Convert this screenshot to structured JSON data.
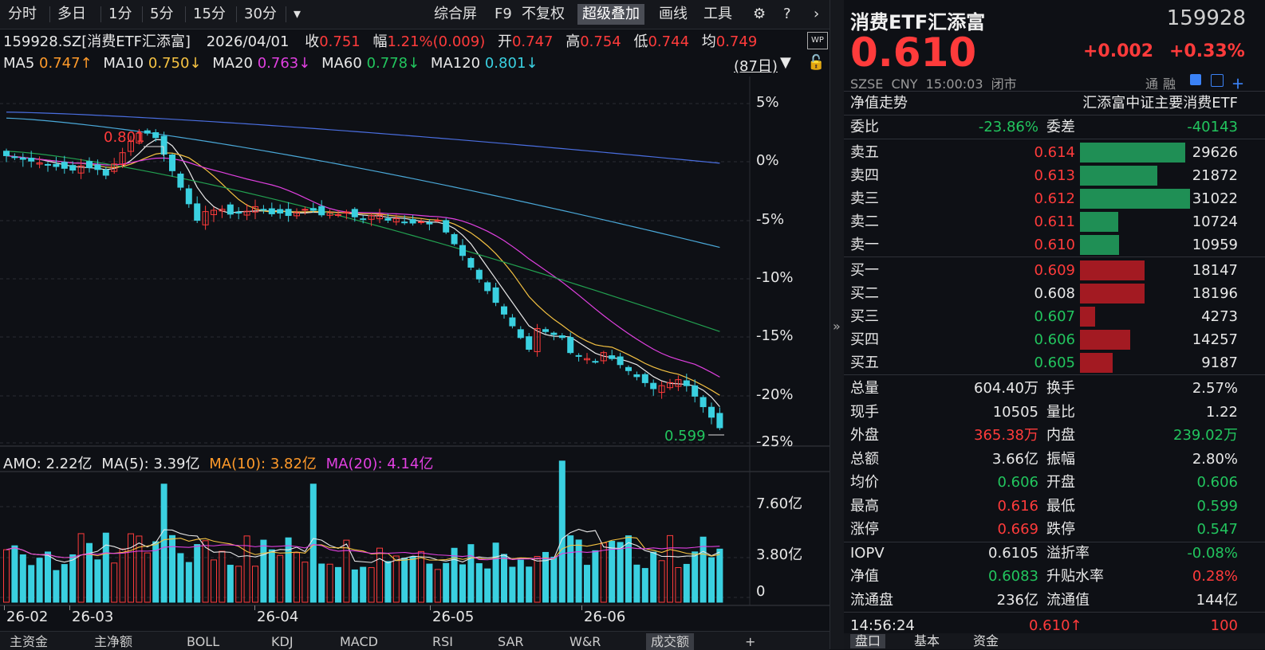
{
  "toolbar": {
    "left_items": [
      "分时",
      "多日",
      "1分",
      "5分",
      "15分",
      "30分",
      "▾"
    ],
    "right_items": [
      "综合屏",
      "F9",
      "不复权",
      "超级叠加",
      "画线",
      "工具"
    ],
    "active": "超级叠加"
  },
  "quote_line": {
    "code": "159928.SZ[消费ETF汇添富]",
    "date": "2026/04/01",
    "close_label": "收",
    "close": "0.751",
    "change_label": "幅",
    "change": "1.21%(0.009)",
    "open_label": "开",
    "open": "0.747",
    "high_label": "高",
    "high": "0.754",
    "low_label": "低",
    "low": "0.744",
    "avg_label": "均",
    "avg": "0.749"
  },
  "ma_line": {
    "ma5_label": "MA5",
    "ma5": "0.747↑",
    "ma10_label": "MA10",
    "ma10": "0.750↓",
    "ma20_label": "MA20",
    "ma20": "0.763↓",
    "ma60_label": "MA60",
    "ma60": "0.778↓",
    "ma120_label": "MA120",
    "ma120": "0.801↓",
    "days": "(87日)"
  },
  "chart_labels": {
    "pct_axis": [
      "5%",
      "0%",
      "-5%",
      "-10%",
      "-15%",
      "-20%",
      "-25%"
    ],
    "vol_axis": [
      "7.60亿",
      "3.80亿",
      "0"
    ],
    "max_mark": "0.801",
    "min_mark": "0.599",
    "amo_label": "AMO: 2.22亿",
    "amo_ma5": "MA(5): 3.39亿",
    "amo_ma10": "MA(10): 3.82亿",
    "amo_ma20": "MA(20): 4.14亿",
    "date_axis": [
      "26-02",
      "26-03",
      "26-04",
      "26-05",
      "26-06"
    ]
  },
  "bottom_tabs": [
    "主资金",
    "主净额",
    "BOLL",
    "KDJ",
    "MACD",
    "RSI",
    "SAR",
    "W&R",
    "成交额",
    "+"
  ],
  "colors": {
    "up": "#ff3b3b",
    "down": "#3ad0e0",
    "ma5": "#e8e8e8",
    "ma10": "#f5c242",
    "ma20": "#e040e0",
    "ma60": "#22a050",
    "ma120": "#4aa8d8",
    "ma250": "#4a6ee0",
    "sell_bar": "#1f8f55",
    "buy_bar": "#a31a22"
  },
  "right_panel": {
    "name": "消费ETF汇添富",
    "code": "159928",
    "price": "0.610",
    "change": "+0.002",
    "change_pct": "+0.33%",
    "meta": "SZSE  CNY  15:00:03  闭市",
    "tong": "通",
    "rong": "融",
    "nav_trend": "净值走势",
    "fund_name": "汇添富中证主要消费ETF",
    "weibi_label": "委比",
    "weibi": "-23.86%",
    "weicha_label": "委差",
    "weicha": "-40143",
    "sells": [
      {
        "label": "卖五",
        "price": "0.614",
        "vol": "29626"
      },
      {
        "label": "卖四",
        "price": "0.613",
        "vol": "21872"
      },
      {
        "label": "卖三",
        "price": "0.612",
        "vol": "31022"
      },
      {
        "label": "卖二",
        "price": "0.611",
        "vol": "10724"
      },
      {
        "label": "卖一",
        "price": "0.610",
        "vol": "10959"
      }
    ],
    "buys": [
      {
        "label": "买一",
        "price": "0.609",
        "vol": "18147"
      },
      {
        "label": "买二",
        "price": "0.608",
        "vol": "18196"
      },
      {
        "label": "买三",
        "price": "0.607",
        "vol": "4273"
      },
      {
        "label": "买四",
        "price": "0.606",
        "vol": "14257"
      },
      {
        "label": "买五",
        "price": "0.605",
        "vol": "9187"
      }
    ],
    "stats": [
      {
        "l1": "总量",
        "v1": "604.40万",
        "c1": "white",
        "l2": "换手",
        "v2": "2.57%",
        "c2": "white"
      },
      {
        "l1": "现手",
        "v1": "10505",
        "c1": "white",
        "l2": "量比",
        "v2": "1.22",
        "c2": "white"
      },
      {
        "l1": "外盘",
        "v1": "365.38万",
        "c1": "red",
        "l2": "内盘",
        "v2": "239.02万",
        "c2": "green"
      },
      {
        "l1": "总额",
        "v1": "3.66亿",
        "c1": "white",
        "l2": "振幅",
        "v2": "2.80%",
        "c2": "white"
      },
      {
        "l1": "均价",
        "v1": "0.606",
        "c1": "green",
        "l2": "开盘",
        "v2": "0.606",
        "c2": "green"
      },
      {
        "l1": "最高",
        "v1": "0.616",
        "c1": "red",
        "l2": "最低",
        "v2": "0.599",
        "c2": "green"
      },
      {
        "l1": "涨停",
        "v1": "0.669",
        "c1": "red",
        "l2": "跌停",
        "v2": "0.547",
        "c2": "green"
      },
      {
        "l1": "IOPV",
        "v1": "0.6105",
        "c1": "white",
        "l2": "溢折率",
        "v2": "-0.08%",
        "c2": "green"
      },
      {
        "l1": "净值",
        "v1": "0.6083",
        "c1": "green",
        "l2": "升贴水率",
        "v2": "0.28%",
        "c2": "red"
      },
      {
        "l1": "流通盘",
        "v1": "236亿",
        "c1": "white",
        "l2": "流通值",
        "v2": "144亿",
        "c2": "white"
      }
    ],
    "tick_time": "14:56:24",
    "tick_price": "0.610↑",
    "tick_vol": "100",
    "right_tabs": [
      "盘口",
      "基本",
      "资金"
    ]
  }
}
